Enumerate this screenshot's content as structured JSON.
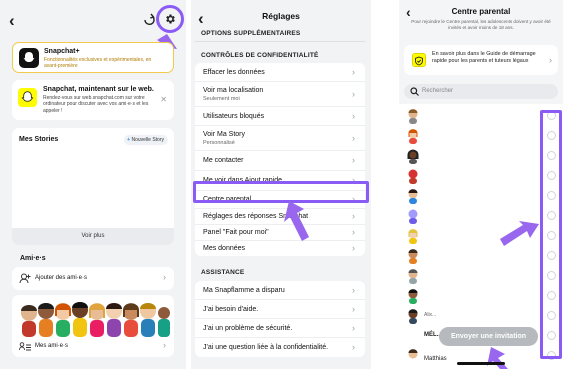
{
  "panel1": {
    "snapchat_plus": {
      "title": "Snapchat+",
      "desc": "Fonctionnalités exclusives et expérimentales, en avant-première"
    },
    "web_banner": {
      "title": "Snapchat, maintenant sur le web.",
      "desc": "Rendez-vous sur web.snapchat.com sur votre ordinateur pour discuter avec vos ami·e·s et les appeler !"
    },
    "stories_title": "Mes Stories",
    "new_story": "Nouvelle Story",
    "see_more": "Voir plus",
    "friends_title": "Ami·e·s",
    "add_friends": "Ajouter des ami·e·s",
    "my_friends": "Mes ami·e·s"
  },
  "panel2": {
    "title": "Réglages",
    "section_extra": "OPTIONS SUPPLÉMENTAIRES",
    "section_privacy": "CONTRÔLES DE CONFIDENTIALITÉ",
    "privacy_items": [
      {
        "label": "Effacer les données",
        "sub": ""
      },
      {
        "label": "Voir ma localisation",
        "sub": "Seulement moi"
      },
      {
        "label": "Utilisateurs bloqués",
        "sub": ""
      },
      {
        "label": "Voir Ma Story",
        "sub": "Personnalisé"
      },
      {
        "label": "Me contacter",
        "sub": ""
      },
      {
        "label": "Me voir dans Ajout rapide",
        "sub": ""
      },
      {
        "label": "Centre parental",
        "sub": ""
      },
      {
        "label": "Réglages des réponses Snapchat",
        "sub": ""
      },
      {
        "label": "Panel \"Fait pour moi\"",
        "sub": ""
      },
      {
        "label": "Mes données",
        "sub": ""
      }
    ],
    "section_assist": "ASSISTANCE",
    "assist_items": [
      {
        "label": "Ma Snapflamme a disparu"
      },
      {
        "label": "J'ai besoin d'aide."
      },
      {
        "label": "J'ai un problème de sécurité."
      },
      {
        "label": "J'ai une question liée à la confidentialité."
      }
    ]
  },
  "panel3": {
    "title": "Centre parental",
    "intro": "Pour rejoindre le Centre parental, les adolescents doivent y avoir été invités et avoir moins de 18 ans.",
    "guide": "En savoir plus dans le Guide de démarrage rapide pour les parents et tuteurs légaux",
    "search_placeholder": "Rechercher",
    "invite_button": "Envoyer une invitation",
    "partial_names": [
      "Alix...",
      "MÉL...",
      "Matthias"
    ]
  },
  "colors": {
    "highlight": "#8a5cf5",
    "arrow": "#9966ee",
    "snap_yellow": "#fffc00"
  }
}
